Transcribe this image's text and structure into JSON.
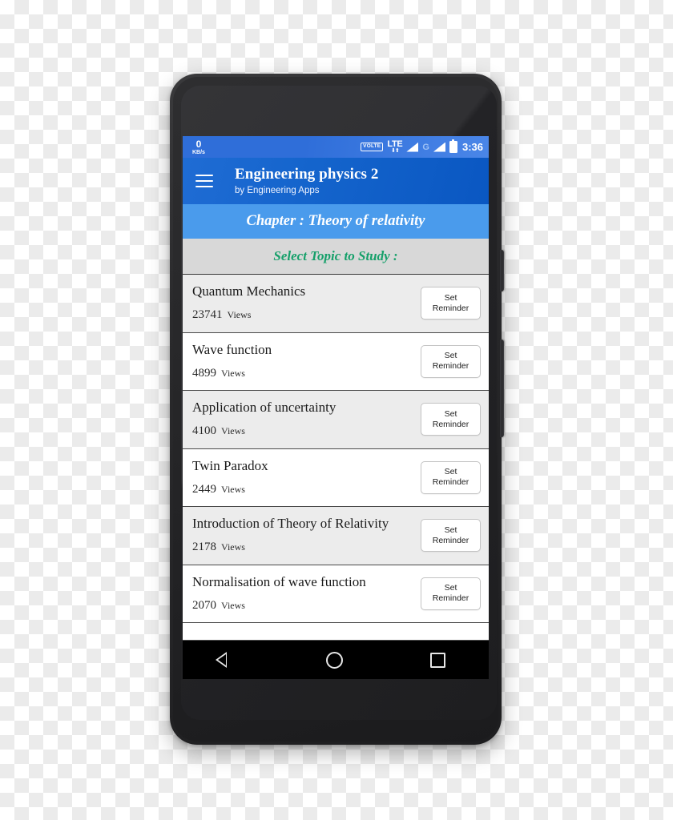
{
  "device": {
    "name": "android-smartphone",
    "hardware": {
      "front_camera": "camera-icon",
      "earpiece": "speaker-grille",
      "bottom_speaker": "speaker-grille",
      "power_button": "power-button",
      "volume_button": "volume-rocker"
    }
  },
  "status_bar": {
    "net_speed_value": "0",
    "net_speed_unit": "KB/s",
    "volte_label": "VOLTE",
    "lte_label": "LTE",
    "lte_arrows": "⬇⬆",
    "sim2_label": "G",
    "signal_icon": "signal-bars-icon",
    "battery_icon": "battery-icon",
    "clock": "3:36",
    "background_color": "#2f6ed9"
  },
  "app_bar": {
    "menu_icon": "hamburger-menu-icon",
    "title": "Engineering physics 2",
    "subtitle": "by Engineering Apps",
    "background_color": "#1464cc"
  },
  "chapter_band": {
    "text": "Chapter : Theory of relativity",
    "background_color": "#4a9bec",
    "text_color": "#ffffff"
  },
  "select_band": {
    "text": "Select Topic to Study :",
    "background_color": "#d8d8d8",
    "text_color": "#16a06a"
  },
  "topic_list": {
    "views_label": "Views",
    "reminder_button_label_line1": "Set",
    "reminder_button_label_line2": "Reminder",
    "items": [
      {
        "title": "Quantum Mechanics",
        "views": "23741",
        "views_label": "Views"
      },
      {
        "title": "Wave function",
        "views": "4899",
        "views_label": "Views"
      },
      {
        "title": "Application of uncertainty",
        "views": "4100",
        "views_label": "Views"
      },
      {
        "title": "Twin Paradox",
        "views": "2449",
        "views_label": "Views"
      },
      {
        "title": "Introduction of Theory of Relativity",
        "views": "2178",
        "views_label": "Views"
      },
      {
        "title": "Normalisation of wave function",
        "views": "2070",
        "views_label": "Views"
      }
    ]
  },
  "nav_bar": {
    "back": "back-triangle-icon",
    "home": "home-circle-icon",
    "recents": "recents-square-icon",
    "background_color": "#000000"
  }
}
